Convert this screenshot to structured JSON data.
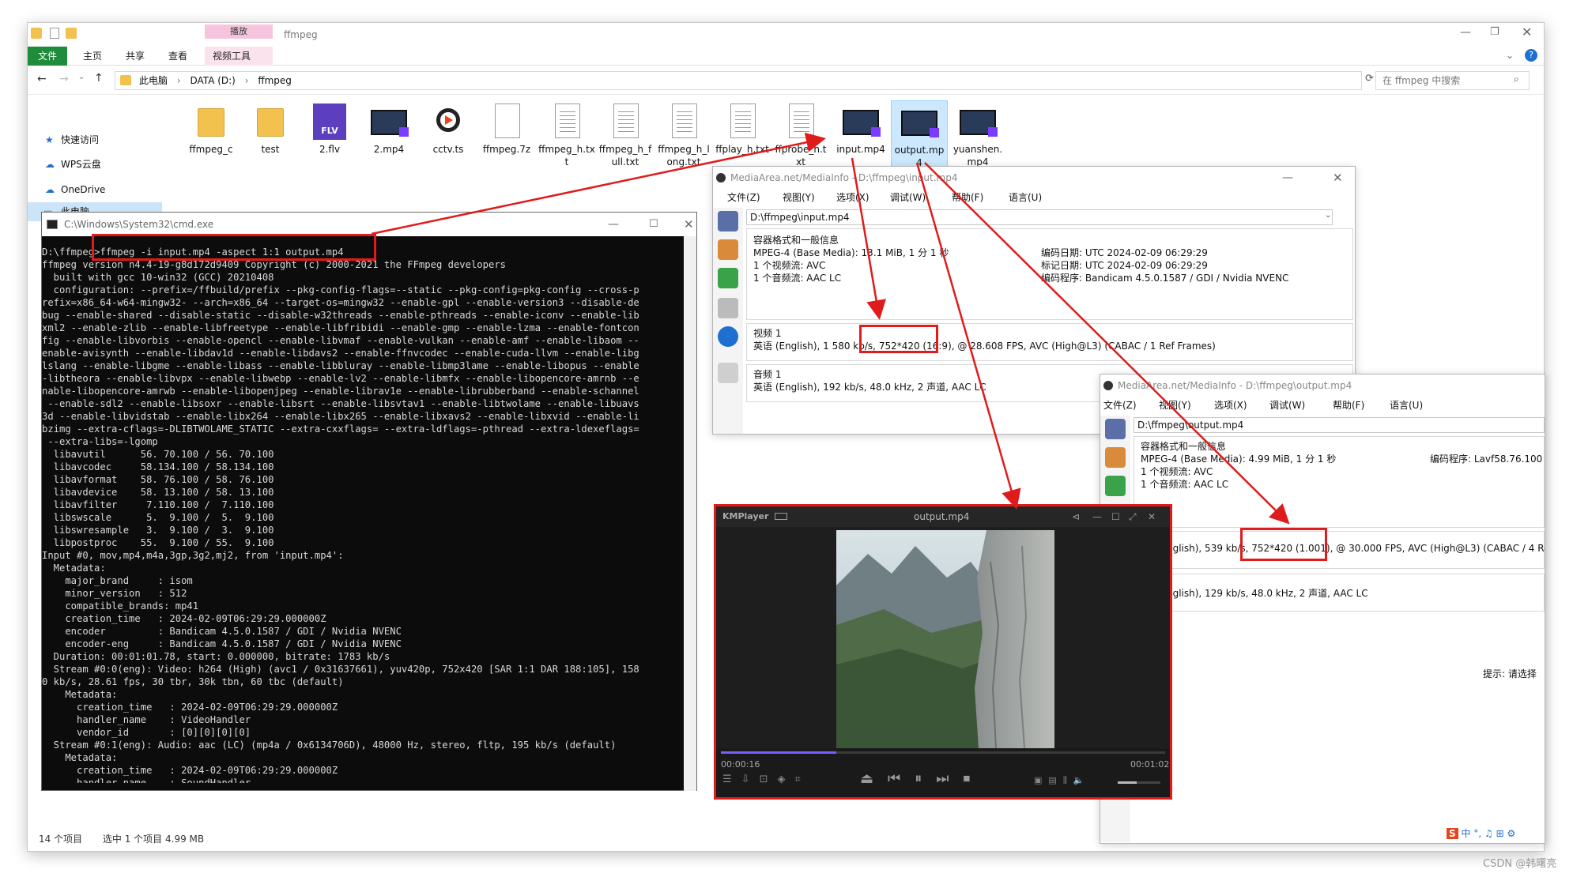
{
  "explorer": {
    "title": "ffmpeg",
    "context_tab_header": "播放",
    "ribbon_tabs": [
      "文件",
      "主页",
      "共享",
      "查看",
      "视频工具"
    ],
    "breadcrumb": [
      "此电脑",
      "DATA (D:)",
      "ffmpeg"
    ],
    "search_placeholder": "在 ffmpeg 中搜索",
    "nav_items": [
      "快速访问",
      "WPS云盘",
      "OneDrive",
      "此电脑"
    ],
    "files": [
      {
        "name": "ffmpeg_c",
        "type": "folder"
      },
      {
        "name": "test",
        "type": "folder"
      },
      {
        "name": "2.flv",
        "type": "flv"
      },
      {
        "name": "2.mp4",
        "type": "video"
      },
      {
        "name": "cctv.ts",
        "type": "media"
      },
      {
        "name": "ffmpeg.7z",
        "type": "archive"
      },
      {
        "name": "ffmpeg_h.txt",
        "type": "text"
      },
      {
        "name": "ffmpeg_h_full.txt",
        "type": "text"
      },
      {
        "name": "ffmpeg_h_long.txt",
        "type": "text"
      },
      {
        "name": "ffplay_h.txt",
        "type": "text"
      },
      {
        "name": "ffprobe_h.txt",
        "type": "text"
      },
      {
        "name": "input.mp4",
        "type": "video"
      },
      {
        "name": "output.mp4",
        "type": "video"
      },
      {
        "name": "yuanshen.mp4",
        "type": "video"
      }
    ],
    "status_count": "14 个项目",
    "status_selected": "选中 1 个项目  4.99 MB"
  },
  "cmd": {
    "title": "C:\\Windows\\System32\\cmd.exe",
    "prompt": "D:\\ffmpeg>",
    "command": "ffmpeg -i input.mp4 -aspect 1:1 output.mp4",
    "output": "ffmpeg version n4.4-19-g8d172d9409 Copyright (c) 2000-2021 the FFmpeg developers\n  built with gcc 10-win32 (GCC) 20210408\n  configuration: --prefix=/ffbuild/prefix --pkg-config-flags=--static --pkg-config=pkg-config --cross-p\nrefix=x86_64-w64-mingw32- --arch=x86_64 --target-os=mingw32 --enable-gpl --enable-version3 --disable-de\nbug --enable-shared --disable-static --disable-w32threads --enable-pthreads --enable-iconv --enable-lib\nxml2 --enable-zlib --enable-libfreetype --enable-libfribidi --enable-gmp --enable-lzma --enable-fontcon\nfig --enable-libvorbis --enable-opencl --enable-libvmaf --enable-vulkan --enable-amf --enable-libaom --\nenable-avisynth --enable-libdav1d --enable-libdavs2 --enable-ffnvcodec --enable-cuda-llvm --enable-libg\nlslang --enable-libgme --enable-libass --enable-libbluray --enable-libmp3lame --enable-libopus --enable\n-libtheora --enable-libvpx --enable-libwebp --enable-lv2 --enable-libmfx --enable-libopencore-amrnb --e\nnable-libopencore-amrwb --enable-libopenjpeg --enable-librav1e --enable-librubberband --enable-schannel\n --enable-sdl2 --enable-libsoxr --enable-libsrt --enable-libsvtav1 --enable-libtwolame --enable-libuavs\n3d --enable-libvidstab --enable-libx264 --enable-libx265 --enable-libxavs2 --enable-libxvid --enable-li\nbzimg --extra-cflags=-DLIBTWOLAME_STATIC --extra-cxxflags= --extra-ldflags=-pthread --extra-ldexeflags=\n --extra-libs=-lgomp\n  libavutil      56. 70.100 / 56. 70.100\n  libavcodec     58.134.100 / 58.134.100\n  libavformat    58. 76.100 / 58. 76.100\n  libavdevice    58. 13.100 / 58. 13.100\n  libavfilter     7.110.100 /  7.110.100\n  libswscale      5.  9.100 /  5.  9.100\n  libswresample   3.  9.100 /  3.  9.100\n  libpostproc    55.  9.100 / 55.  9.100\nInput #0, mov,mp4,m4a,3gp,3g2,mj2, from 'input.mp4':\n  Metadata:\n    major_brand     : isom\n    minor_version   : 512\n    compatible_brands: mp41\n    creation_time   : 2024-02-09T06:29:29.000000Z\n    encoder         : Bandicam 4.5.0.1587 / GDI / Nvidia NVENC\n    encoder-eng     : Bandicam 4.5.0.1587 / GDI / Nvidia NVENC\n  Duration: 00:01:01.78, start: 0.000000, bitrate: 1783 kb/s\n  Stream #0:0(eng): Video: h264 (High) (avc1 / 0x31637661), yuv420p, 752x420 [SAR 1:1 DAR 188:105], 158\n0 kb/s, 28.61 fps, 30 tbr, 30k tbn, 60 tbc (default)\n    Metadata:\n      creation_time   : 2024-02-09T06:29:29.000000Z\n      handler_name    : VideoHandler\n      vendor_id       : [0][0][0][0]\n  Stream #0:1(eng): Audio: aac (LC) (mp4a / 0x6134706D), 48000 Hz, stereo, fltp, 195 kb/s (default)\n    Metadata:\n      creation_time   : 2024-02-09T06:29:29.000000Z\n      handler_name    : SoundHandler"
  },
  "mediainfo_input": {
    "title": "MediaArea.net/MediaInfo - D:\\ffmpeg\\input.mp4",
    "menu": [
      "文件(Z)",
      "视图(Y)",
      "选项(X)",
      "调试(W)",
      "帮助(F)",
      "语言(U)"
    ],
    "path": "D:\\ffmpeg\\input.mp4",
    "general_header": "容器格式和一般信息",
    "general_lines": [
      "MPEG-4 (Base Media): 13.1 MiB, 1 分 1 秒",
      "1 个视频流: AVC",
      "1 个音频流: AAC LC"
    ],
    "general_right": [
      "编码日期: UTC 2024-02-09 06:29:29",
      "标记日期: UTC 2024-02-09 06:29:29",
      "编码程序: Bandicam 4.5.0.1587 / GDI / Nvidia NVENC"
    ],
    "video_header": "视频 1",
    "video_pre": "英语 (English), 1 580 kb/s,",
    "video_hl": "752*420 (16:9),",
    "video_post": "@ 28.608 FPS, AVC (High@L3) (CABAC / 1 Ref Frames)",
    "audio_header": "音频 1",
    "audio_line": "英语 (English), 192 kb/s, 48.0 kHz, 2 声道, AAC LC"
  },
  "mediainfo_output": {
    "title": "MediaArea.net/MediaInfo - D:\\ffmpeg\\output.mp4",
    "menu": [
      "文件(Z)",
      "视图(Y)",
      "选项(X)",
      "调试(W)",
      "帮助(F)",
      "语言(U)"
    ],
    "path": "D:\\ffmpeg\\output.mp4",
    "general_header": "容器格式和一般信息",
    "general_lines": [
      "MPEG-4 (Base Media): 4.99 MiB, 1 分 1 秒",
      "1 个视频流: AVC",
      "1 个音频流: AAC LC"
    ],
    "general_right": "编码程序: Lavf58.76.100",
    "video_pre": "nglish), 539 kb/s,",
    "video_hl": "752*420 (1.001),",
    "video_post": "@ 30.000 FPS, AVC (High@L3) (CABAC / 4 Ref Fran",
    "audio_line": "nglish), 129 kb/s, 48.0 kHz, 2 声道, AAC LC",
    "hint": "提示: 请选择"
  },
  "kmplayer": {
    "brand": "KMPlayer",
    "title": "output.mp4",
    "time_current": "00:00:16",
    "time_total": "00:01:02",
    "progress": 0.26,
    "volume": 0.45
  },
  "watermark": "CSDN @韩曙亮",
  "tray": [
    "中",
    "°,",
    "♫",
    "⊞",
    "⚙"
  ],
  "colors": {
    "annotation_red": "#e01b1b",
    "ribbon_file_green": "#1e8c3a",
    "selection_blue": "#cce8ff"
  }
}
